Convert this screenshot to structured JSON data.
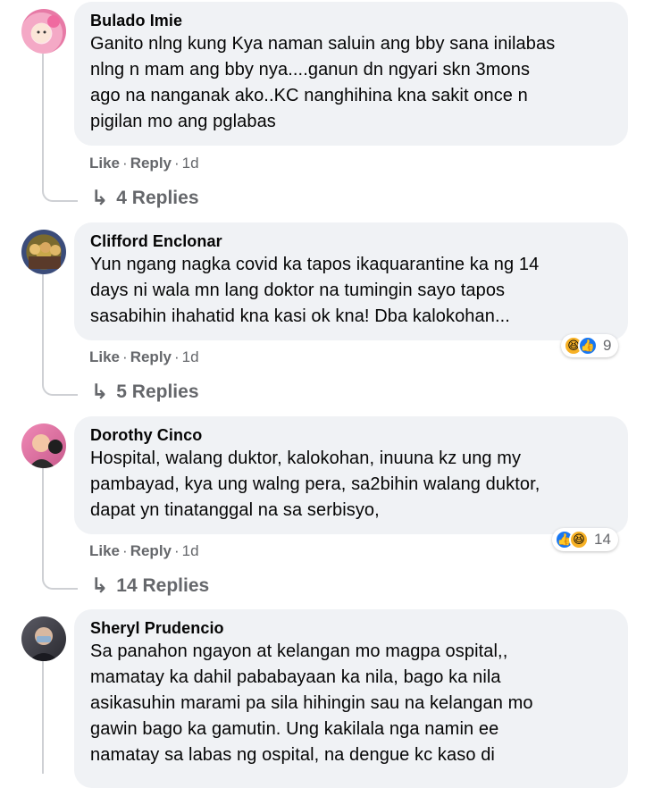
{
  "comments": [
    {
      "author": "Bulado Imie",
      "text": "Ganito nlng kung Kya naman saluin ang bby sana inilabas\nnlng n mam ang bby nya....ganun dn ngyari skn 3mons\nago na nanganak ako..KC nanghihina kna sakit once n\npigilan mo ang pglabas",
      "like": "Like",
      "reply": "Reply",
      "time": "1d",
      "replies": "4 Replies",
      "avatar_color": "#f4a9c6"
    },
    {
      "author": "Clifford Enclonar",
      "text": "Yun ngang nagka covid ka tapos ikaquarantine ka ng 14\ndays ni wala mn lang doktor na tumingin sayo tapos\nsasabihin ihahatid kna kasi ok kna! Dba kalokohan...",
      "like": "Like",
      "reply": "Reply",
      "time": "1d",
      "replies": "5 Replies",
      "reaction_count": "9",
      "avatar_color": "#7a6a2e"
    },
    {
      "author": "Dorothy Cinco",
      "text": "Hospital, walang duktor, kalokohan, inuuna kz ung my\npambayad, kya ung walng pera, sa2bihin walang duktor,\ndapat yn tinatanggal na sa serbisyo,",
      "like": "Like",
      "reply": "Reply",
      "time": "1d",
      "replies": "14 Replies",
      "reaction_count": "14",
      "avatar_color": "#e86aa0"
    },
    {
      "author": "Sheryl Prudencio",
      "text": "Sa panahon ngayon at kelangan mo magpa ospital,,\nmamatay ka dahil pababayaan ka nila, bago ka nila\nasikasuhin marami pa sila hihingin sau na kelangan mo\ngawin bago ka gamutin. Ung kakilala nga namin ee\nnamatay sa labas ng ospital, na dengue kc kaso di",
      "avatar_color": "#3a3a40"
    }
  ],
  "icons": {
    "reply_arrow": "reply-arrow-icon",
    "haha": "haha-reaction-icon",
    "like": "like-reaction-icon"
  },
  "colors": {
    "bubble": "#f0f2f5",
    "secondary_text": "#65676b",
    "like_blue": "#1877f2",
    "haha_yellow": "#f7b125"
  }
}
